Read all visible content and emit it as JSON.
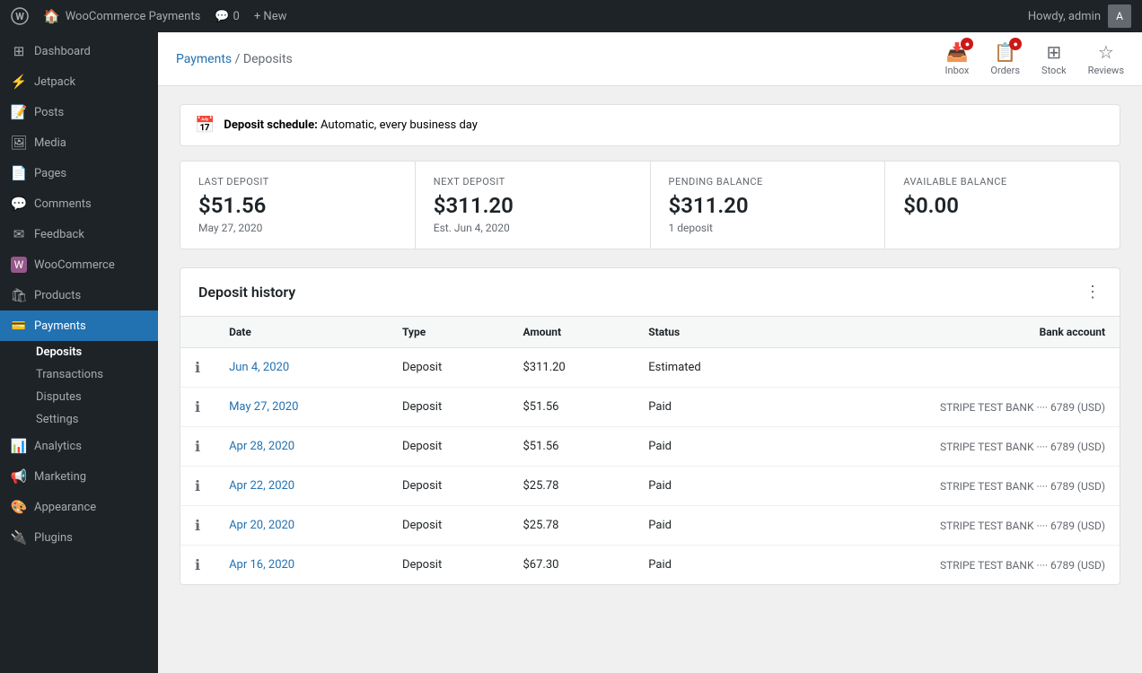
{
  "adminbar": {
    "site_name": "WooCommerce Payments",
    "comments_label": "0",
    "new_label": "+ New",
    "howdy": "Howdy, admin"
  },
  "sidebar": {
    "items": [
      {
        "id": "dashboard",
        "label": "Dashboard",
        "icon": "⊞"
      },
      {
        "id": "jetpack",
        "label": "Jetpack",
        "icon": "⚡"
      },
      {
        "id": "posts",
        "label": "Posts",
        "icon": "📝"
      },
      {
        "id": "media",
        "label": "Media",
        "icon": "🖼"
      },
      {
        "id": "pages",
        "label": "Pages",
        "icon": "📄"
      },
      {
        "id": "comments",
        "label": "Comments",
        "icon": "💬"
      },
      {
        "id": "feedback",
        "label": "Feedback",
        "icon": "✉"
      },
      {
        "id": "woocommerce",
        "label": "WooCommerce",
        "icon": "Ⓦ"
      },
      {
        "id": "products",
        "label": "Products",
        "icon": "🛍"
      },
      {
        "id": "payments",
        "label": "Payments",
        "icon": "💳",
        "active": true
      }
    ],
    "payments_sub": [
      {
        "id": "deposits",
        "label": "Deposits",
        "active": true
      },
      {
        "id": "transactions",
        "label": "Transactions"
      },
      {
        "id": "disputes",
        "label": "Disputes"
      },
      {
        "id": "settings",
        "label": "Settings"
      }
    ],
    "bottom_items": [
      {
        "id": "analytics",
        "label": "Analytics",
        "icon": "📊"
      },
      {
        "id": "marketing",
        "label": "Marketing",
        "icon": "📢"
      },
      {
        "id": "appearance",
        "label": "Appearance",
        "icon": "🎨"
      },
      {
        "id": "plugins",
        "label": "Plugins",
        "icon": "🔌"
      }
    ]
  },
  "topbar": {
    "breadcrumb_link": "Payments",
    "breadcrumb_current": "Deposits",
    "inbox_label": "Inbox",
    "orders_label": "Orders",
    "stock_label": "Stock",
    "reviews_label": "Reviews",
    "inbox_badge": "",
    "orders_badge": ""
  },
  "deposit_schedule": {
    "label": "Deposit schedule:",
    "value": "Automatic, every business day"
  },
  "stats": {
    "last_deposit": {
      "label": "LAST DEPOSIT",
      "value": "$51.56",
      "sub": "May 27, 2020"
    },
    "next_deposit": {
      "label": "NEXT DEPOSIT",
      "value": "$311.20",
      "sub": "Est. Jun 4, 2020"
    },
    "pending_balance": {
      "label": "PENDING BALANCE",
      "value": "$311.20",
      "sub": "1 deposit"
    },
    "available_balance": {
      "label": "AVAILABLE BALANCE",
      "value": "$0.00",
      "sub": ""
    }
  },
  "history": {
    "title": "Deposit history",
    "columns": {
      "date": "Date",
      "type": "Type",
      "amount": "Amount",
      "status": "Status",
      "bank": "Bank account"
    },
    "rows": [
      {
        "date": "Jun 4, 2020",
        "type": "Deposit",
        "amount": "$311.20",
        "status": "Estimated",
        "bank": ""
      },
      {
        "date": "May 27, 2020",
        "type": "Deposit",
        "amount": "$51.56",
        "status": "Paid",
        "bank": "STRIPE TEST BANK ···· 6789 (USD)"
      },
      {
        "date": "Apr 28, 2020",
        "type": "Deposit",
        "amount": "$51.56",
        "status": "Paid",
        "bank": "STRIPE TEST BANK ···· 6789 (USD)"
      },
      {
        "date": "Apr 22, 2020",
        "type": "Deposit",
        "amount": "$25.78",
        "status": "Paid",
        "bank": "STRIPE TEST BANK ···· 6789 (USD)"
      },
      {
        "date": "Apr 20, 2020",
        "type": "Deposit",
        "amount": "$25.78",
        "status": "Paid",
        "bank": "STRIPE TEST BANK ···· 6789 (USD)"
      },
      {
        "date": "Apr 16, 2020",
        "type": "Deposit",
        "amount": "$67.30",
        "status": "Paid",
        "bank": "STRIPE TEST BANK ···· 6789 (USD)"
      }
    ]
  }
}
